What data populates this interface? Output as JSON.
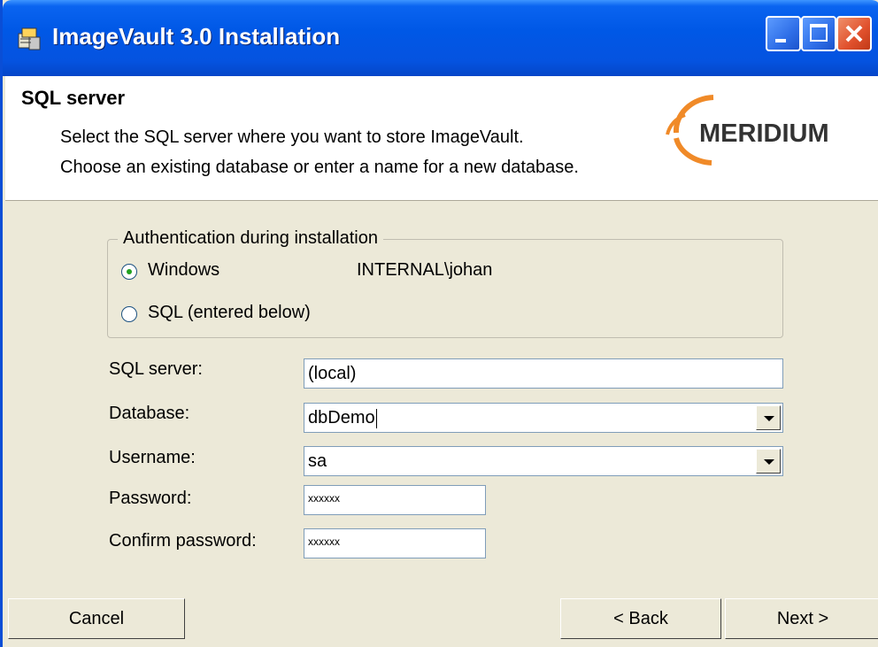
{
  "window": {
    "title": "ImageVault 3.0 Installation",
    "icon": "installer-icon"
  },
  "header": {
    "title": "SQL server",
    "description_line1": "Select the SQL server where you want to store ImageVault.",
    "description_line2": "Choose an existing database or enter a name for a new database.",
    "logo_text": "MERIDIUM",
    "logo_color": "#f08a28"
  },
  "authentication": {
    "legend": "Authentication during installation",
    "windows_label": "Windows",
    "windows_user": "INTERNAL\\johan",
    "sql_label": "SQL (entered below)",
    "selected": "windows"
  },
  "form": {
    "sql_server_label": "SQL server:",
    "sql_server_value": "(local)",
    "database_label": "Database:",
    "database_value": "dbDemo",
    "username_label": "Username:",
    "username_value": "sa",
    "password_label": "Password:",
    "password_value": "xxxxxx",
    "confirm_password_label": "Confirm password:",
    "confirm_password_value": "xxxxxx"
  },
  "buttons": {
    "cancel": "Cancel",
    "back": "< Back",
    "next": "Next >"
  }
}
